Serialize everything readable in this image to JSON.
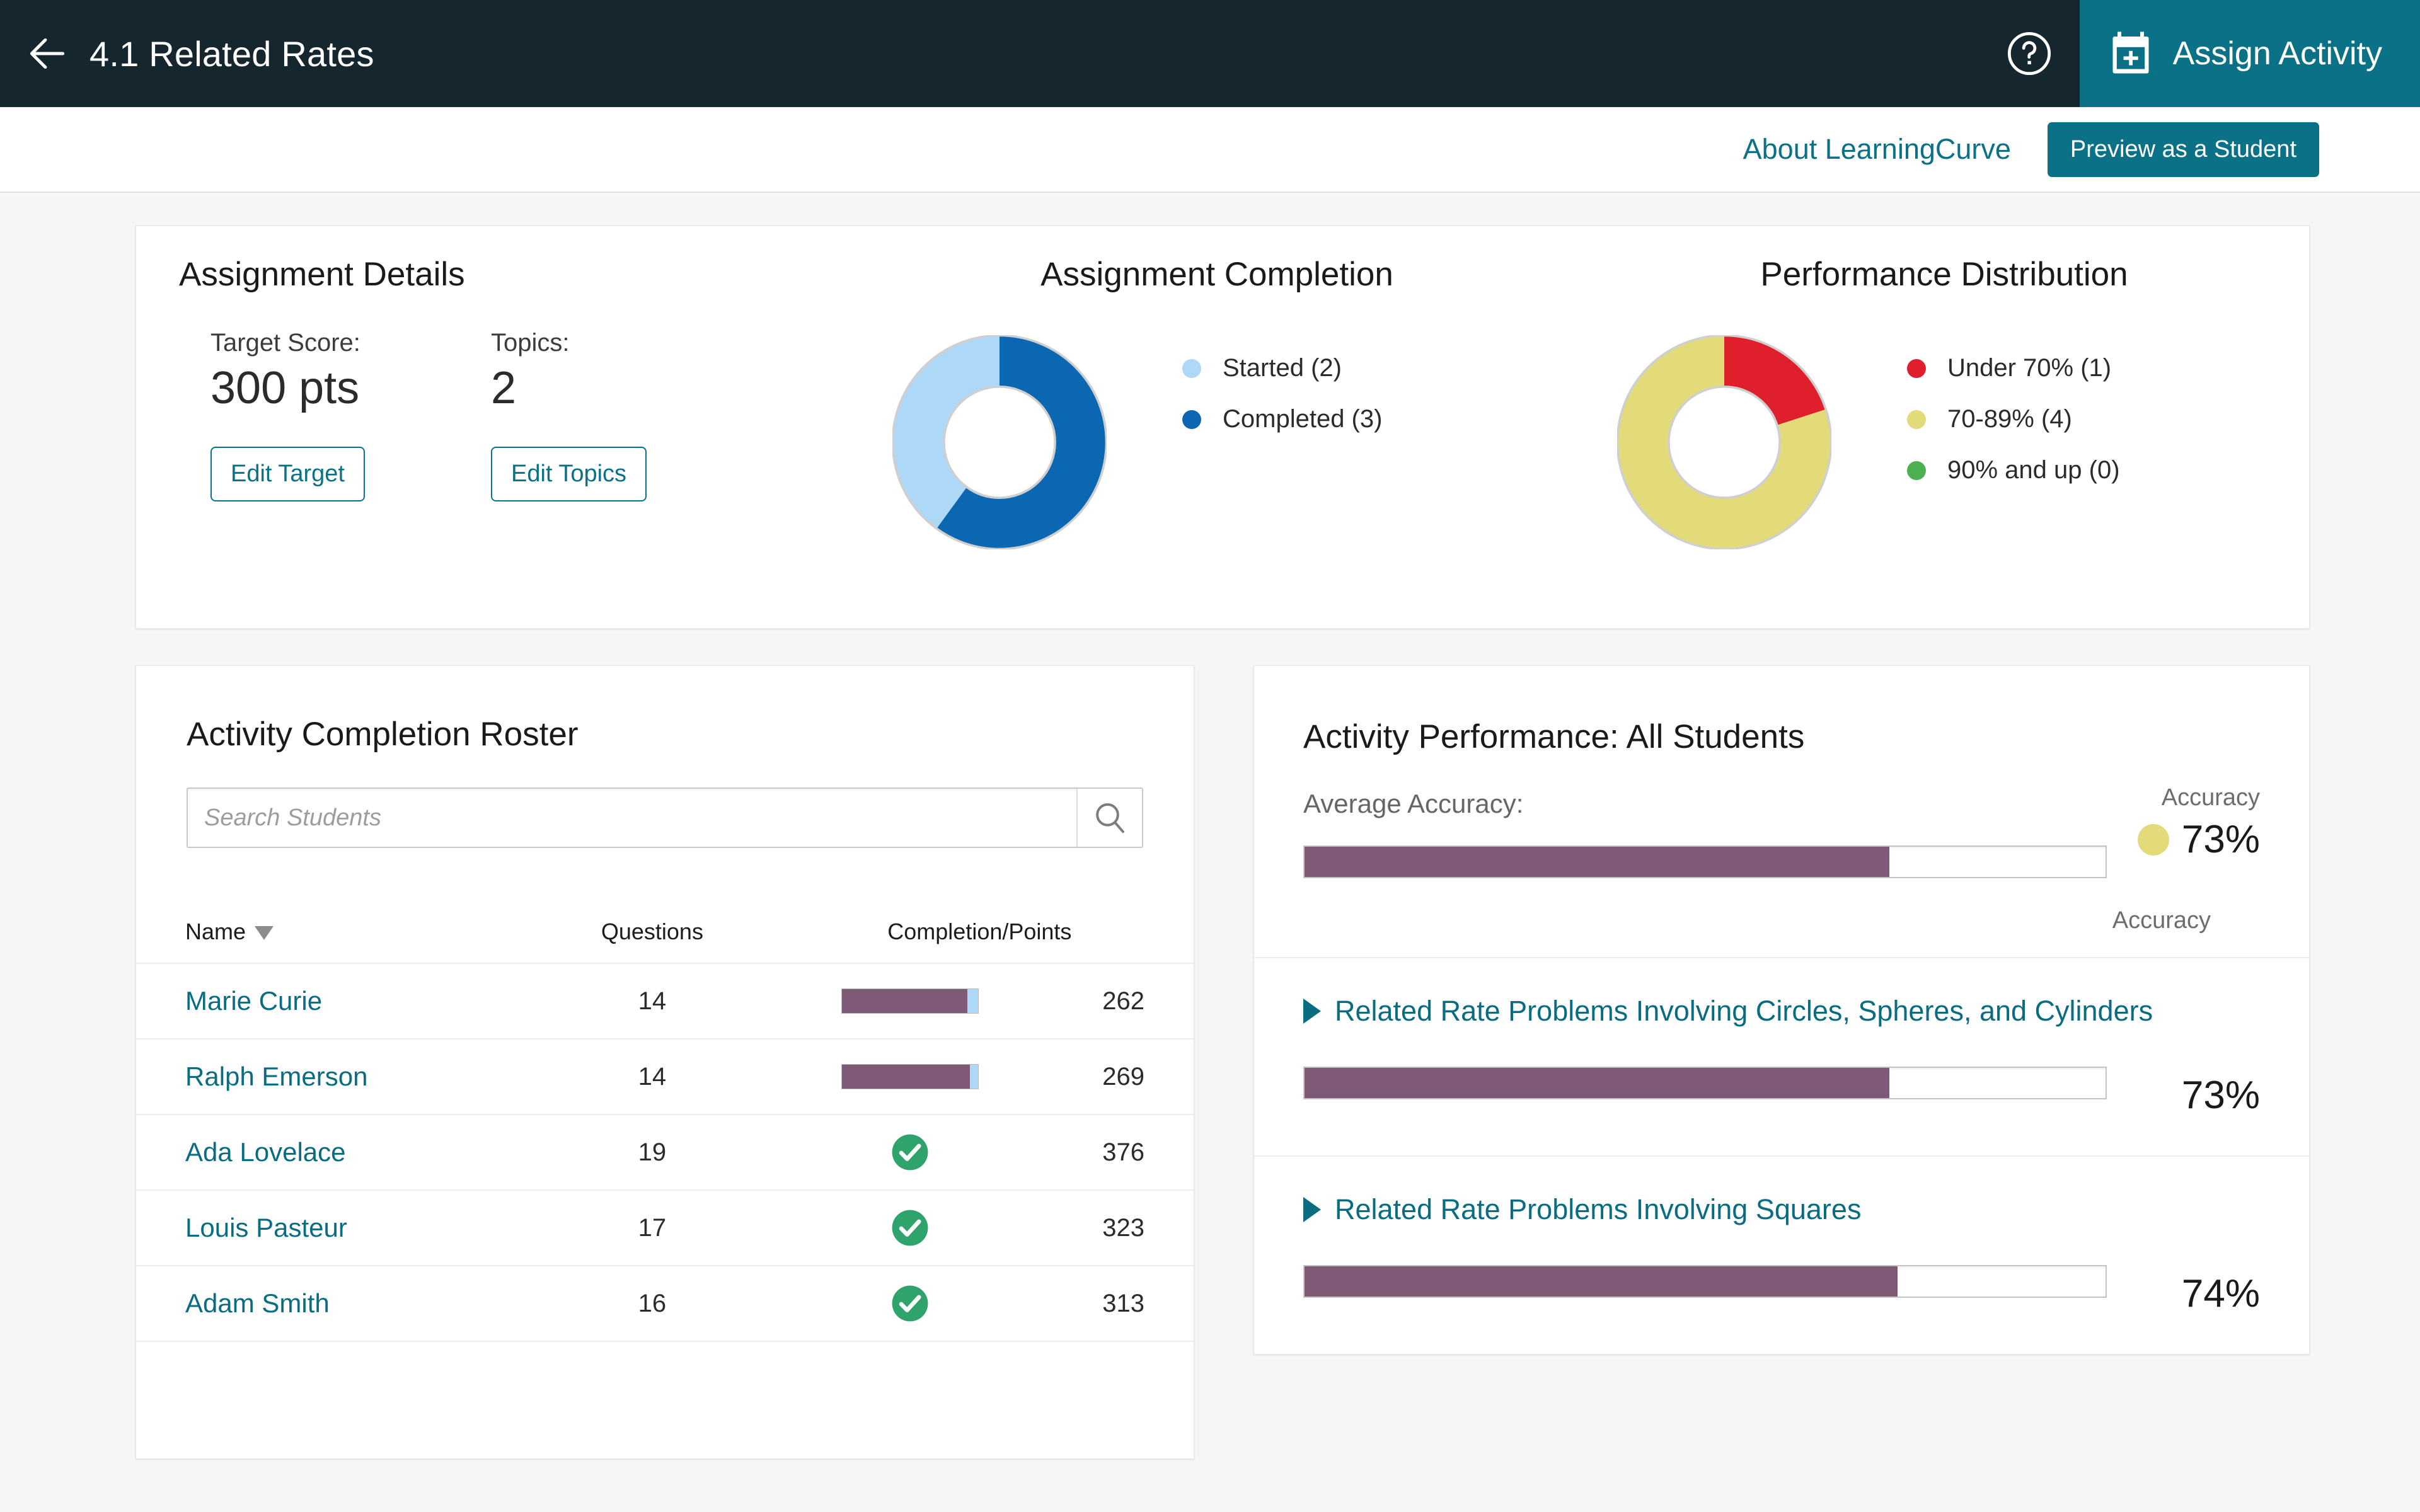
{
  "header": {
    "back_icon": "arrow-left-icon",
    "title": "4.1 Related Rates",
    "help_icon": "help-circle-icon",
    "assign_icon": "calendar-plus-icon",
    "assign_label": "Assign Activity",
    "bg_color": "#16262e",
    "accent_color": "#0a7186"
  },
  "subheader": {
    "about_link": "About LearningCurve",
    "preview_button": "Preview as a Student"
  },
  "assignment_details": {
    "title": "Assignment Details",
    "target_score_label": "Target Score:",
    "target_score_value": "300 pts",
    "edit_target_button": "Edit Target",
    "topics_label": "Topics:",
    "topics_value": "2",
    "edit_topics_button": "Edit Topics"
  },
  "assignment_completion": {
    "title": "Assignment Completion",
    "legend": [
      {
        "label": "Started (2)",
        "color": "#aed8f7"
      },
      {
        "label": "Completed (3)",
        "color": "#0b67b2"
      }
    ]
  },
  "performance_distribution": {
    "title": "Performance Distribution",
    "legend": [
      {
        "label": "Under 70% (1)",
        "color": "#e01f2d"
      },
      {
        "label": "70-89% (4)",
        "color": "#e3db79"
      },
      {
        "label": "90% and up (0)",
        "color": "#4caf50"
      }
    ]
  },
  "roster": {
    "title": "Activity Completion Roster",
    "search_placeholder": "Search Students",
    "search_value": "",
    "search_icon": "search-icon",
    "columns": [
      "Name",
      "Questions",
      "Completion/Points"
    ],
    "sort_column": "Name",
    "rows": [
      {
        "name": "Marie Curie",
        "questions": "14",
        "status": "bar",
        "progress": 92,
        "points": "262"
      },
      {
        "name": "Ralph Emerson",
        "questions": "14",
        "status": "bar",
        "progress": 94,
        "points": "269"
      },
      {
        "name": "Ada Lovelace",
        "questions": "19",
        "status": "check",
        "progress": 100,
        "points": "376"
      },
      {
        "name": "Louis Pasteur",
        "questions": "17",
        "status": "check",
        "progress": 100,
        "points": "323"
      },
      {
        "name": "Adam Smith",
        "questions": "16",
        "status": "check",
        "progress": 100,
        "points": "313"
      }
    ]
  },
  "activity_performance": {
    "title": "Activity Performance: All Students",
    "average_label": "Average Accuracy:",
    "accuracy_header": "Accuracy",
    "average_accuracy": "73%",
    "average_accuracy_value": 73,
    "average_dot_color": "#e3db79",
    "accuracy_column_header": "Accuracy",
    "topics": [
      {
        "name": "Related Rate Problems Involving Circles, Spheres, and Cylinders",
        "accuracy": "73%",
        "accuracy_value": 73
      },
      {
        "name": "Related Rate Problems Involving Squares",
        "accuracy": "74%",
        "accuracy_value": 74
      }
    ]
  },
  "chart_data": [
    {
      "type": "pie",
      "title": "Assignment Completion",
      "labels": [
        "Started",
        "Completed"
      ],
      "values": [
        2,
        3
      ],
      "colors": [
        "#aed8f7",
        "#0b67b2"
      ],
      "legend_entries": [
        "Started (2)",
        "Completed (3)"
      ],
      "legend_position": "right",
      "donut": true
    },
    {
      "type": "pie",
      "title": "Performance Distribution",
      "labels": [
        "Under 70%",
        "70-89%",
        "90% and up"
      ],
      "values": [
        1,
        4,
        0
      ],
      "colors": [
        "#e01f2d",
        "#e3db79",
        "#4caf50"
      ],
      "legend_entries": [
        "Under 70% (1)",
        "70-89% (4)",
        "90% and up (0)"
      ],
      "legend_position": "right",
      "donut": true
    },
    {
      "type": "bar",
      "title": "Activity Performance: All Students",
      "orientation": "horizontal",
      "categories": [
        "Average Accuracy",
        "Related Rate Problems Involving Circles, Spheres, and Cylinders",
        "Related Rate Problems Involving Squares"
      ],
      "values": [
        73,
        74
      ],
      "series": [
        {
          "name": "Accuracy",
          "values": [
            73,
            73,
            74
          ]
        }
      ],
      "ylabel": "Accuracy",
      "xlim": [
        0,
        100
      ],
      "grid": false
    },
    {
      "type": "table",
      "title": "Activity Completion Roster",
      "columns": [
        "Name",
        "Questions",
        "Completion/Points"
      ],
      "rows": [
        [
          "Marie Curie",
          14,
          262
        ],
        [
          "Ralph Emerson",
          14,
          269
        ],
        [
          "Ada Lovelace",
          19,
          376
        ],
        [
          "Louis Pasteur",
          17,
          323
        ],
        [
          "Adam Smith",
          16,
          313
        ]
      ]
    }
  ]
}
